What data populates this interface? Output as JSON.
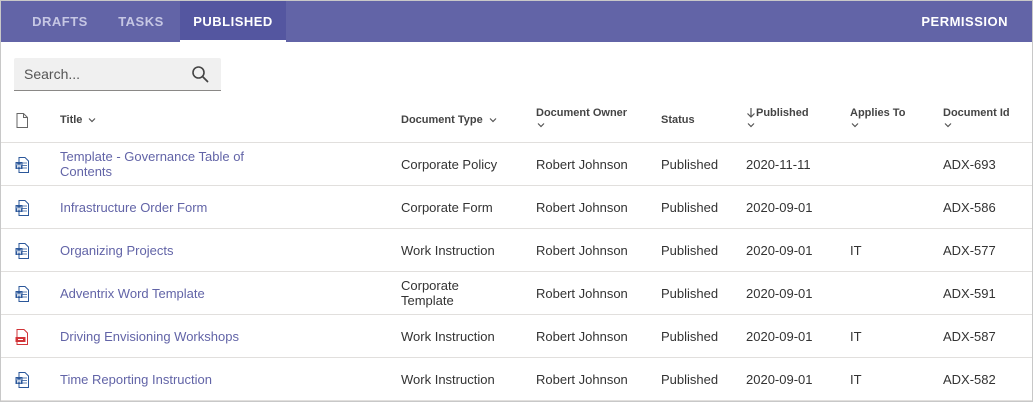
{
  "tabs": {
    "drafts": "DRAFTS",
    "tasks": "TASKS",
    "published": "PUBLISHED",
    "active": "published"
  },
  "permission_label": "PERMISSION",
  "search": {
    "placeholder": "Search...",
    "value": ""
  },
  "columns": {
    "title": "Title",
    "document_type": "Document Type",
    "document_owner": "Document Owner",
    "status": "Status",
    "published": "Published",
    "applies_to": "Applies To",
    "document_id": "Document Id"
  },
  "rows": [
    {
      "icon": "word-document-icon",
      "title": "Template - Governance Table of Contents",
      "type": "Corporate Policy",
      "owner": "Robert Johnson",
      "status": "Published",
      "published": "2020-11-11",
      "applies_to": "",
      "id": "ADX-693"
    },
    {
      "icon": "word-document-icon",
      "title": "Infrastructure Order Form",
      "type": "Corporate Form",
      "owner": "Robert Johnson",
      "status": "Published",
      "published": "2020-09-01",
      "applies_to": "",
      "id": "ADX-586"
    },
    {
      "icon": "word-document-icon",
      "title": "Organizing Projects",
      "type": "Work Instruction",
      "owner": "Robert Johnson",
      "status": "Published",
      "published": "2020-09-01",
      "applies_to": "IT",
      "id": "ADX-577"
    },
    {
      "icon": "word-document-icon",
      "title": "Adventrix Word Template",
      "type": "Corporate Template",
      "owner": "Robert Johnson",
      "status": "Published",
      "published": "2020-09-01",
      "applies_to": "",
      "id": "ADX-591"
    },
    {
      "icon": "pdf-document-icon",
      "title": "Driving Envisioning Workshops",
      "type": "Work Instruction",
      "owner": "Robert Johnson",
      "status": "Published",
      "published": "2020-09-01",
      "applies_to": "IT",
      "id": "ADX-587"
    },
    {
      "icon": "word-document-icon",
      "title": "Time Reporting Instruction",
      "type": "Work Instruction",
      "owner": "Robert Johnson",
      "status": "Published",
      "published": "2020-09-01",
      "applies_to": "IT",
      "id": "ADX-582"
    }
  ],
  "colors": {
    "tabbar": "#6264a7",
    "link": "#6264a7",
    "word_icon": "#2b579a",
    "pdf_icon": "#d13438"
  }
}
